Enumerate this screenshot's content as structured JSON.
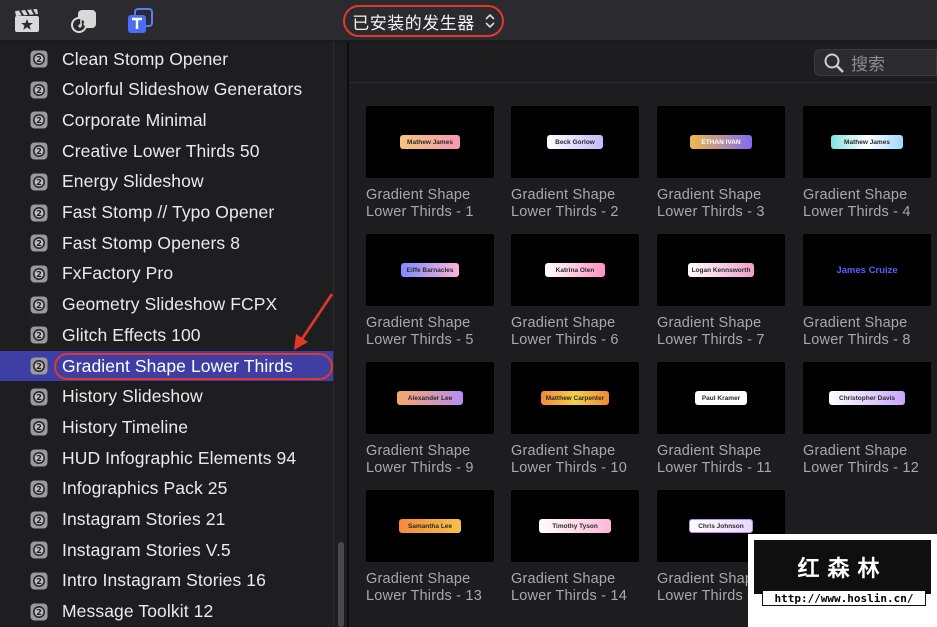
{
  "toolbar": {
    "icons": [
      "clapperboard-star-icon",
      "music-note-icon",
      "title-T-icon"
    ],
    "generator_select": {
      "label": "已安装的发生器",
      "chevron": "up-down-chevron"
    }
  },
  "colors": {
    "selection": "#3e3fa4",
    "highlight_ring": "#e0392b",
    "background": "#1d1d1f"
  },
  "sidebar": {
    "items": [
      {
        "label": "Clean Stomp Opener"
      },
      {
        "label": "Colorful Slideshow Generators"
      },
      {
        "label": "Corporate Minimal"
      },
      {
        "label": "Creative Lower Thirds 50"
      },
      {
        "label": "Energy Slideshow"
      },
      {
        "label": "Fast Stomp // Typo Opener"
      },
      {
        "label": "Fast Stomp Openers 8"
      },
      {
        "label": "FxFactory Pro"
      },
      {
        "label": "Geometry Slideshow FCPX"
      },
      {
        "label": "Glitch Effects 100"
      },
      {
        "label": "Gradient Shape Lower Thirds",
        "selected": true
      },
      {
        "label": "History Slideshow"
      },
      {
        "label": "History Timeline"
      },
      {
        "label": "HUD Infographic Elements 94"
      },
      {
        "label": "Infographics Pack 25"
      },
      {
        "label": "Instagram Stories 21"
      },
      {
        "label": "Instagram Stories V.5"
      },
      {
        "label": "Intro Instagram Stories 16"
      },
      {
        "label": "Message Toolkit 12"
      }
    ]
  },
  "search": {
    "placeholder": "搜索"
  },
  "tiles": [
    {
      "line1": "Gradient Shape",
      "line2": "Lower Thirds - 1",
      "preview": "Mathew James"
    },
    {
      "line1": "Gradient Shape",
      "line2": "Lower Thirds - 2",
      "preview": "Beck Gorlow"
    },
    {
      "line1": "Gradient Shape",
      "line2": "Lower Thirds - 3",
      "preview": "ETHAN IVAN"
    },
    {
      "line1": "Gradient Shape",
      "line2": "Lower Thirds - 4",
      "preview": "Mathew James"
    },
    {
      "line1": "Gradient Shape",
      "line2": "Lower Thirds - 5",
      "preview": "Eiffe Barnacles"
    },
    {
      "line1": "Gradient Shape",
      "line2": "Lower Thirds - 6",
      "preview": "Katrina Olen"
    },
    {
      "line1": "Gradient Shape",
      "line2": "Lower Thirds - 7",
      "preview": "Logan Kennsworth"
    },
    {
      "line1": "Gradient Shape",
      "line2": "Lower Thirds - 8",
      "preview": "James Cruize"
    },
    {
      "line1": "Gradient Shape",
      "line2": "Lower Thirds - 9",
      "preview": "Alexander Lee"
    },
    {
      "line1": "Gradient Shape",
      "line2": "Lower Thirds - 10",
      "preview": "Matthew Carpenter"
    },
    {
      "line1": "Gradient Shape",
      "line2": "Lower Thirds - 11",
      "preview": "Paul Kramer"
    },
    {
      "line1": "Gradient Shape",
      "line2": "Lower Thirds - 12",
      "preview": "Christopher Davis"
    },
    {
      "line1": "Gradient Shape",
      "line2": "Lower Thirds - 13",
      "preview": "Samantha Lee"
    },
    {
      "line1": "Gradient Shape",
      "line2": "Lower Thirds - 14",
      "preview": "Timothy Tyson"
    },
    {
      "line1": "Gradient Shape",
      "line2": "Lower Thirds - 15",
      "preview": "Chris Johnson"
    }
  ],
  "watermark": {
    "brand": "红森林",
    "url": "http://www.hoslin.cn/"
  }
}
